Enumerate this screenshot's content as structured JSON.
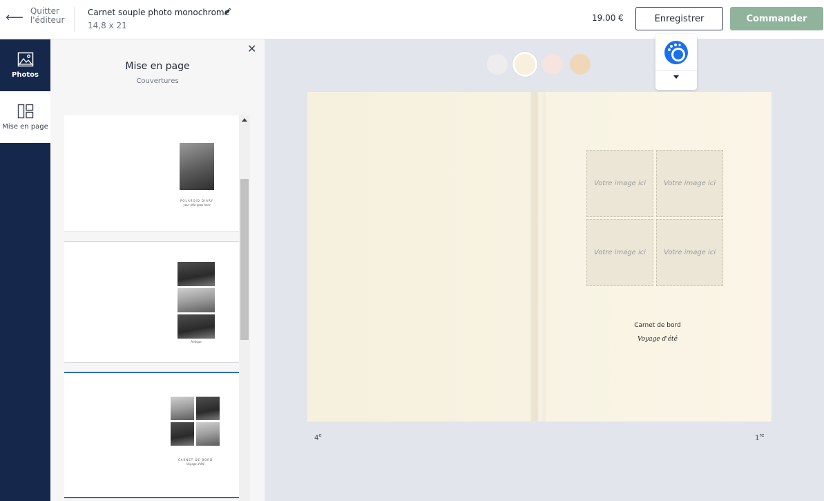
{
  "header": {
    "quit_label": "Quitter l'éditeur",
    "doc_title": "Carnet souple photo monochrome",
    "doc_size": "14,8 x 21",
    "price": "19.00 €",
    "save_label": "Enregistrer",
    "order_label": "Commander"
  },
  "rail": {
    "photos_label": "Photos",
    "layout_label": "Mise en page"
  },
  "panel": {
    "title": "Mise en page",
    "subtitle": "Couvertures",
    "thumb1_line1": "POLAROID DIARY",
    "thumb1_line2": "your title goes here",
    "thumb2_line": "Antique",
    "thumb3_line1": "CARNET DE BORD",
    "thumb3_line2": "Voyage d'été"
  },
  "colors": {
    "accent": "#15284b",
    "order_button": "#8fb39b",
    "selected_outline": "#2d6cc4",
    "swatches": [
      "#ededed",
      "#f6f0dc",
      "#f6e4e1",
      "#efd8b9"
    ]
  },
  "canvas": {
    "slot_label": "Votre image ici",
    "cover_title": "Carnet de bord",
    "cover_subtitle": "Voyage d'été",
    "back_page_num": "4",
    "back_page_sup": "e",
    "front_page_num": "1",
    "front_page_sup": "re"
  }
}
